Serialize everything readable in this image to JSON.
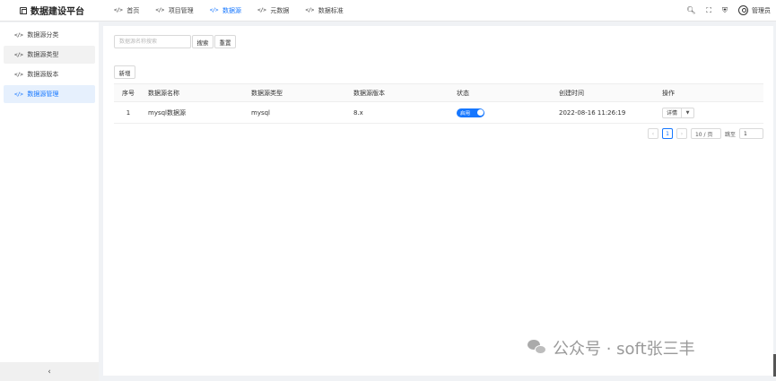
{
  "app": {
    "title": "数据建设平台"
  },
  "top_nav": [
    {
      "label": "首页",
      "active": false
    },
    {
      "label": "项目管理",
      "active": false
    },
    {
      "label": "数据源",
      "active": true
    },
    {
      "label": "元数据",
      "active": false
    },
    {
      "label": "数据标准",
      "active": false
    }
  ],
  "top_right": {
    "user_name": "管理员"
  },
  "sidebar": {
    "items": [
      {
        "label": "数据源分类"
      },
      {
        "label": "数据源类型"
      },
      {
        "label": "数据源版本"
      },
      {
        "label": "数据源管理"
      }
    ],
    "active_index": 3,
    "collapse_glyph": "‹"
  },
  "search": {
    "placeholder": "数据源名称搜索",
    "search_label": "搜索",
    "reset_label": "重置"
  },
  "toolbar": {
    "add_label": "新增"
  },
  "table": {
    "columns": [
      "序号",
      "数据源名称",
      "数据源类型",
      "数据源版本",
      "状态",
      "创建时间",
      "操作"
    ],
    "rows": [
      {
        "index": "1",
        "name": "mysql数据源",
        "type": "mysql",
        "version": "8.x",
        "status": "启用",
        "status_on": true,
        "created": "2022-08-16 11:26:19",
        "action": "详情"
      }
    ]
  },
  "pagination": {
    "prev": "‹",
    "current": "1",
    "next": "›",
    "page_size": "10 / 页",
    "jump_label": "跳至",
    "jump_value": "1"
  },
  "watermark": {
    "text": "公众号 · soft张三丰"
  },
  "colors": {
    "accent": "#1677ff",
    "active_bg": "#e6f0fd"
  }
}
